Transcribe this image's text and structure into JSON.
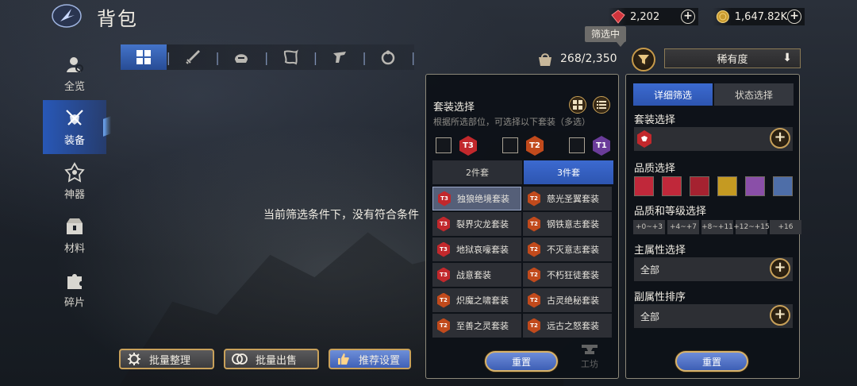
{
  "header": {
    "title": "背包",
    "ruby_amount": "2,202",
    "gold_amount": "1,647.82K"
  },
  "nav": [
    {
      "label": "全览",
      "icon": "search-user-icon",
      "active": false
    },
    {
      "label": "装备",
      "icon": "crossed-swords-shield-icon",
      "active": true
    },
    {
      "label": "神器",
      "icon": "artifact-crest-icon",
      "active": false
    },
    {
      "label": "材料",
      "icon": "materials-box-icon",
      "active": false
    },
    {
      "label": "碎片",
      "icon": "puzzle-piece-icon",
      "active": false
    }
  ],
  "tabs": [
    "grid-all-icon",
    "sword-icon",
    "helmet-icon",
    "cape-icon",
    "boots-icon",
    "ring-icon"
  ],
  "main": {
    "empty_message": "当前筛选条件下，没有符合条件"
  },
  "capacity": "268/2,350",
  "filter_tip": "筛选中",
  "sort_label": "稀有度",
  "set_panel": {
    "title": "套装选择",
    "subtitle": "根据所选部位，可选择以下套装（多选）",
    "tiers": [
      "T3",
      "T2",
      "T1"
    ],
    "piece_tabs": [
      "2件套",
      "3件套"
    ],
    "sets": [
      {
        "name": "独狼绝境套装",
        "tier": "T3",
        "active": true
      },
      {
        "name": "慈光圣翼套装",
        "tier": "T2",
        "active": false
      },
      {
        "name": "裂界灾龙套装",
        "tier": "T3",
        "active": false
      },
      {
        "name": "钢铁意志套装",
        "tier": "T2",
        "active": false
      },
      {
        "name": "地狱哀嚎套装",
        "tier": "T3",
        "active": false
      },
      {
        "name": "不灭意志套装",
        "tier": "T2",
        "active": false
      },
      {
        "name": "战意套装",
        "tier": "T3",
        "active": false
      },
      {
        "name": "不朽狂徒套装",
        "tier": "T2",
        "active": false
      },
      {
        "name": "炽魔之啸套装",
        "tier": "T2",
        "active": false
      },
      {
        "name": "古灵绝秘套装",
        "tier": "T2",
        "active": false
      },
      {
        "name": "至善之灵套装",
        "tier": "T2",
        "active": false
      },
      {
        "name": "远古之怒套装",
        "tier": "T2",
        "active": false
      }
    ],
    "reset_label": "重置"
  },
  "detail_panel": {
    "tabs": [
      "详细筛选",
      "状态选择"
    ],
    "set_label": "套装选择",
    "quality_label": "品质选择",
    "quality_colors": [
      "#c0283a",
      "#c0283a",
      "#a52230",
      "#c59a22",
      "#8a4fa8",
      "#4e6ea8"
    ],
    "quality_level_label": "品质和等级选择",
    "levels": [
      "+0~+3",
      "+4~+7",
      "+8~+11",
      "+12~+15",
      "+16"
    ],
    "main_attr_label": "主属性选择",
    "main_attr_value": "全部",
    "sub_attr_label": "副属性排序",
    "sub_attr_value": "全部",
    "reset_label": "重置"
  },
  "bottom": {
    "batch_organize": "批量整理",
    "batch_sell": "批量出售",
    "recommend": "推荐设置",
    "craft": "工坊"
  },
  "colors": {
    "accent_blue": "#3c6ad0",
    "gold_border": "#c9a15a",
    "tier_t3": "#c2282c",
    "tier_t2": "#c14a1c",
    "tier_t1": "#6a3c9a"
  }
}
